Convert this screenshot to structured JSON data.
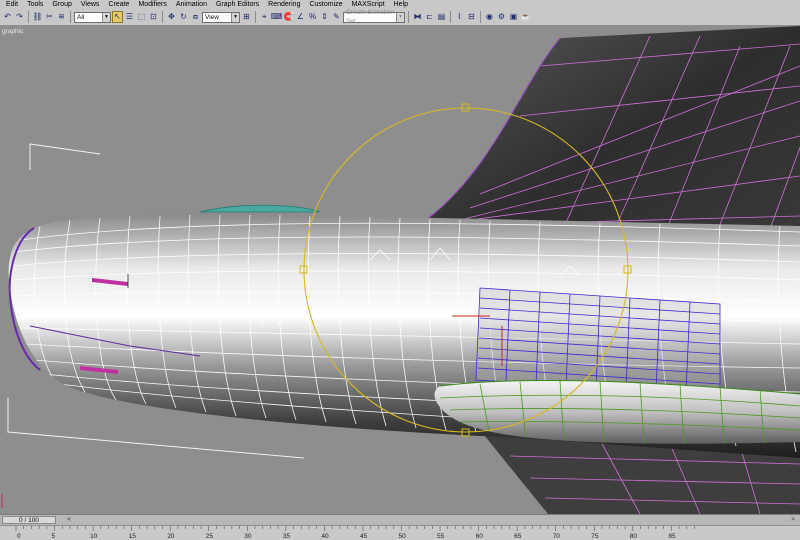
{
  "menu": {
    "items": [
      "Edit",
      "Tools",
      "Group",
      "Views",
      "Create",
      "Modifiers",
      "Animation",
      "Graph Editors",
      "Rendering",
      "Customize",
      "MAXScript",
      "Help"
    ]
  },
  "toolbar": {
    "selection_filter": "All",
    "reference_coordinate_system": "View",
    "named_selection_set_placeholder": "Create Selection Set",
    "active_tool": "select-object"
  },
  "viewport": {
    "label": "graphic",
    "background_color": "#8e8e8e",
    "wireframe_color": "#ffffff",
    "selected_edge_color": "#5a2a9a",
    "gizmo_color": "#e0c020"
  },
  "timeline": {
    "current_frame_display": "0 / 100",
    "prev_label": "<",
    "next_label": ">",
    "ticks": [
      "0",
      "5",
      "10",
      "15",
      "20",
      "25",
      "30",
      "35",
      "40",
      "45",
      "50",
      "55",
      "60",
      "65",
      "70",
      "75",
      "80",
      "85"
    ]
  }
}
